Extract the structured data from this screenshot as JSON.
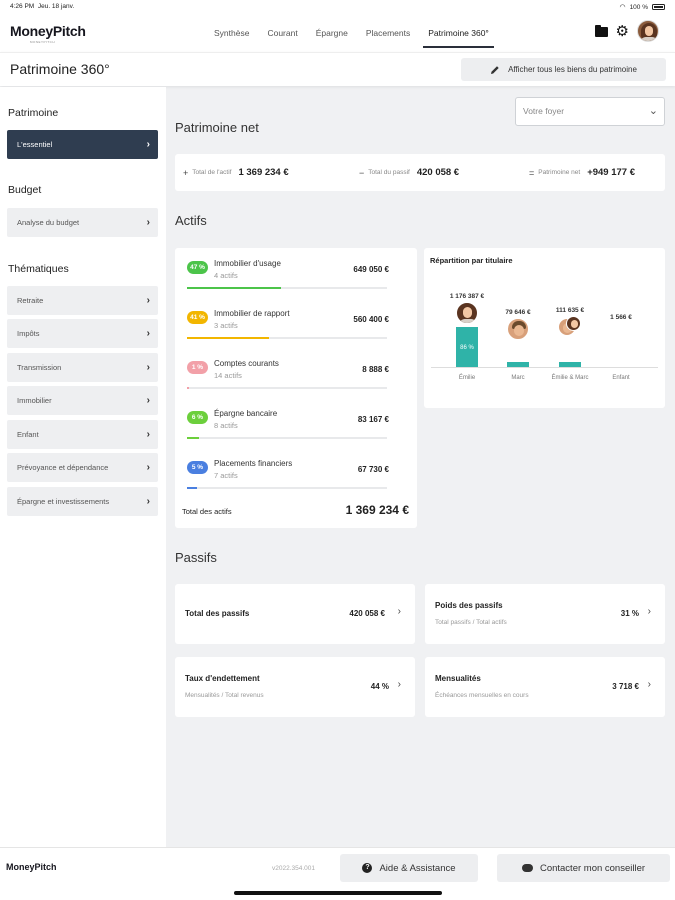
{
  "status": {
    "time": "4:26 PM",
    "date": "Jeu. 18 janv.",
    "battery": "100 %"
  },
  "brand": {
    "name": "MoneyPitch",
    "tagline": "MONEYPITCH"
  },
  "nav": {
    "tabs": [
      {
        "label": "Synthèse"
      },
      {
        "label": "Courant"
      },
      {
        "label": "Épargne"
      },
      {
        "label": "Placements"
      },
      {
        "label": "Patrimoine 360°",
        "active": true
      }
    ]
  },
  "page": {
    "title": "Patrimoine 360°",
    "show_all_button": "Afficher tous les biens du patrimoine"
  },
  "sidebar": {
    "section_patrimoine": "Patrimoine",
    "essentiel": "L'essentiel",
    "section_budget": "Budget",
    "budget_item": "Analyse du budget",
    "section_thematiques": "Thématiques",
    "thematiques": [
      {
        "label": "Retraite"
      },
      {
        "label": "Impôts"
      },
      {
        "label": "Transmission"
      },
      {
        "label": "Immobilier"
      },
      {
        "label": "Enfant"
      },
      {
        "label": "Prévoyance et dépendance"
      },
      {
        "label": "Épargne et investissements"
      }
    ]
  },
  "foyer_select": {
    "placeholder": "Votre foyer"
  },
  "net": {
    "title": "Patrimoine net",
    "total_actif_label": "Total de l'actif",
    "total_actif_value": "1 369 234 €",
    "total_passif_label": "Total du passif",
    "total_passif_value": "420 058 €",
    "net_label": "Patrimoine net",
    "net_value": "+949 177 €"
  },
  "actifs": {
    "title": "Actifs",
    "rows": [
      {
        "pct": "47 %",
        "pct_value": 47,
        "name": "Immobilier d'usage",
        "count": "4 actifs",
        "value": "649 050 €",
        "color": "#4cc44a"
      },
      {
        "pct": "41 %",
        "pct_value": 41,
        "name": "Immobilier de rapport",
        "count": "3 actifs",
        "value": "560 400 €",
        "color": "#f2b600"
      },
      {
        "pct": "1 %",
        "pct_value": 1,
        "name": "Comptes courants",
        "count": "14 actifs",
        "value": "8 888 €",
        "color": "#f2a0a8"
      },
      {
        "pct": "6 %",
        "pct_value": 6,
        "name": "Épargne bancaire",
        "count": "8 actifs",
        "value": "83 167 €",
        "color": "#6ccf3c"
      },
      {
        "pct": "5 %",
        "pct_value": 5,
        "name": "Placements financiers",
        "count": "7 actifs",
        "value": "67 730 €",
        "color": "#4a7fe0"
      }
    ],
    "total_label": "Total des actifs",
    "total_value": "1 369 234 €"
  },
  "repartition": {
    "title": "Répartition par titulaire",
    "holders": [
      {
        "name": "Émilie",
        "amount": "1 176 387 €",
        "pct": "86 %",
        "share": 86
      },
      {
        "name": "Marc",
        "amount": "79 646 €",
        "share": 6
      },
      {
        "name": "Émilie & Marc",
        "amount": "111 635 €",
        "share": 8
      },
      {
        "name": "Enfant",
        "amount": "1 566 €",
        "share": 0
      }
    ]
  },
  "passifs": {
    "title": "Passifs",
    "cards": [
      {
        "label": "Total des passifs",
        "sub": "",
        "value": "420 058 €"
      },
      {
        "label": "Poids des passifs",
        "sub": "Total passifs / Total actifs",
        "value": "31 %"
      },
      {
        "label": "Taux d'endettement",
        "sub": "Mensualités / Total revenus",
        "value": "44 %"
      },
      {
        "label": "Mensualités",
        "sub": "Échéances mensuelles en cours",
        "value": "3 718 €"
      }
    ]
  },
  "footer": {
    "logo": "MoneyPitch",
    "version": "v2022.354.001",
    "help_button": "Aide & Assistance",
    "contact_button": "Contacter mon conseiller"
  },
  "colors": {
    "accent_dark": "#2f3d50",
    "teal": "#2fb3a8"
  },
  "icons": [
    "folder-icon",
    "gear-icon",
    "pencil-icon",
    "chevron-right-icon",
    "chevron-down-icon",
    "help-icon",
    "chat-icon",
    "wifi-icon",
    "battery-icon"
  ]
}
